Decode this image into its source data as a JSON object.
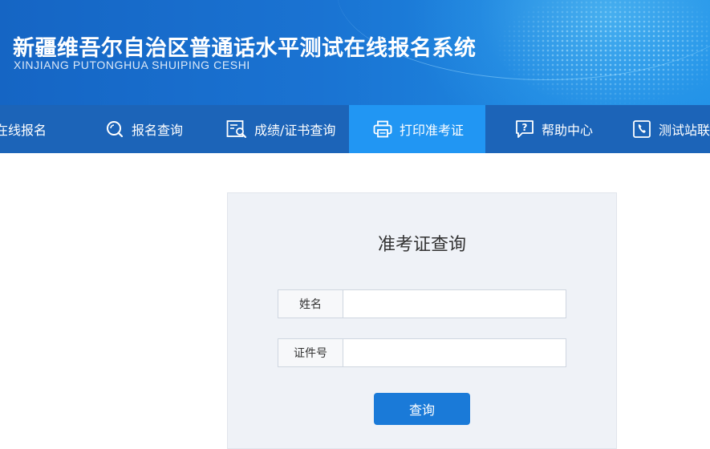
{
  "header": {
    "title": "新疆维吾尔自治区普通话水平测试在线报名系统",
    "subtitle": "XINJIANG PUTONGHUA SHUIPING CESHI"
  },
  "nav": {
    "items": [
      {
        "label": "在线报名",
        "icon": "none",
        "active": false
      },
      {
        "label": "报名查询",
        "icon": "search-icon",
        "active": false
      },
      {
        "label": "成绩/证书查询",
        "icon": "certificate-search-icon",
        "active": false
      },
      {
        "label": "打印准考证",
        "icon": "printer-icon",
        "active": true
      },
      {
        "label": "帮助中心",
        "icon": "help-icon",
        "active": false
      },
      {
        "label": "测试站联系",
        "icon": "phone-icon",
        "active": false
      }
    ]
  },
  "form": {
    "title": "准考证查询",
    "name_label": "姓名",
    "name_value": "",
    "id_label": "证件号",
    "id_value": "",
    "submit_label": "查询"
  },
  "colors": {
    "header_blue": "#1a73d2",
    "nav_blue": "#1c64b8",
    "nav_active": "#2196f3",
    "button_blue": "#1a7ad8",
    "panel_bg": "#eff2f7"
  }
}
